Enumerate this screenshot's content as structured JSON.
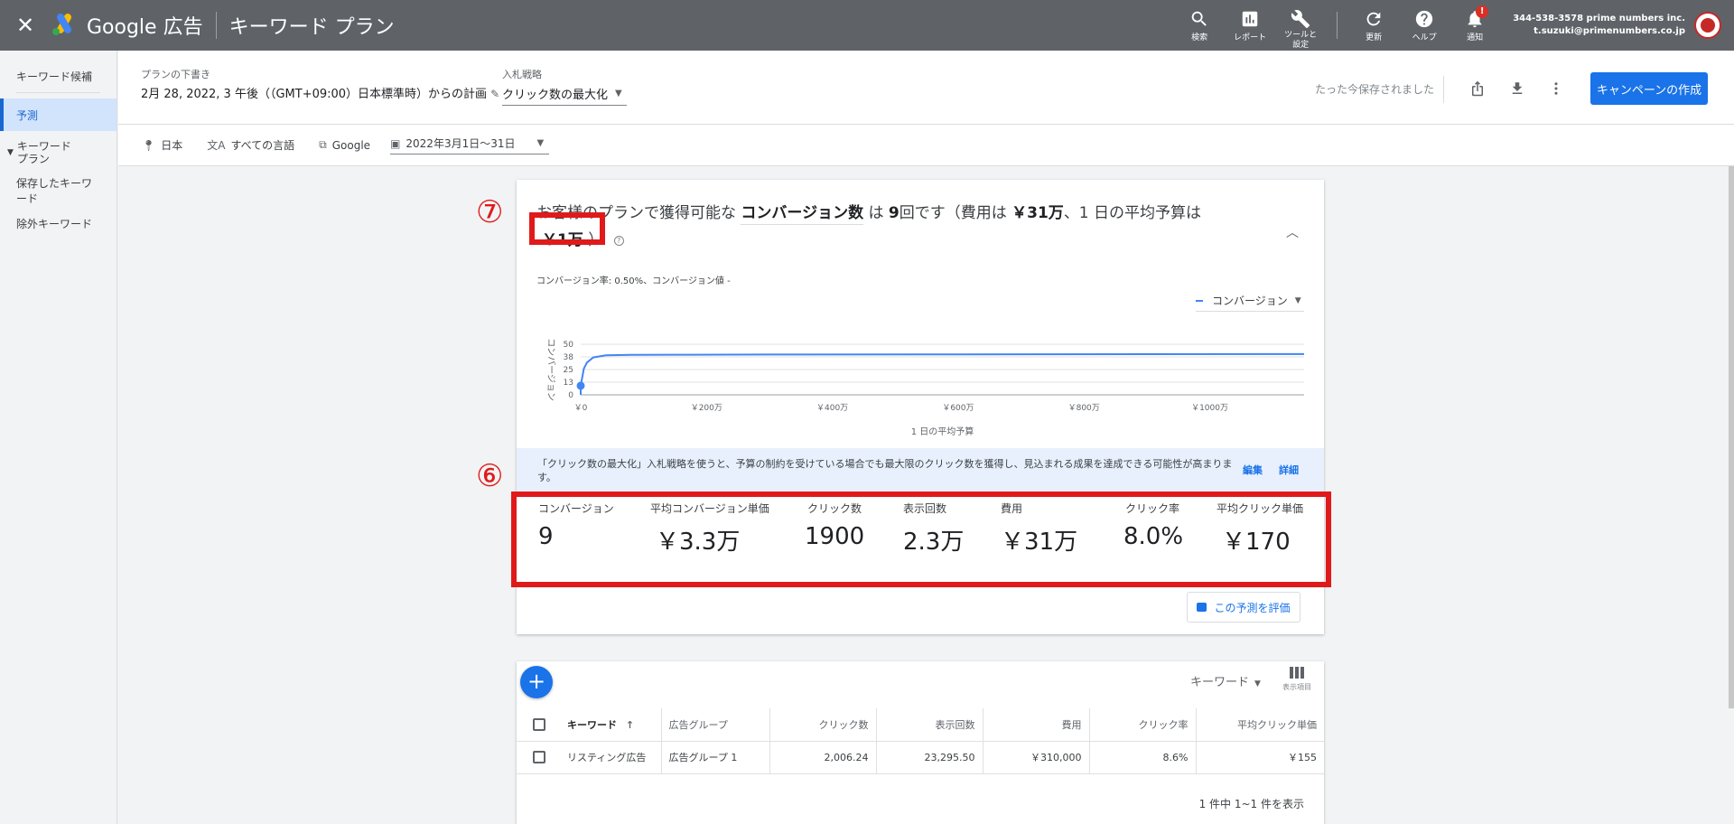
{
  "topbar": {
    "product": "Google 広告",
    "page_title": "キーワード プラン",
    "buttons": [
      {
        "label": "検索",
        "icon": "search-icon"
      },
      {
        "label": "レポート",
        "icon": "report-icon"
      },
      {
        "label": "ツールと設定",
        "icon": "wrench-icon"
      },
      {
        "label": "更新",
        "icon": "refresh-icon"
      },
      {
        "label": "ヘルプ",
        "icon": "help-icon"
      },
      {
        "label": "通知",
        "icon": "bell-icon",
        "badge": "!"
      }
    ],
    "account_id": "344-538-3578 prime numbers inc.",
    "account_email": "t.suzuki@primenumbers.co.jp"
  },
  "sidebar": {
    "items": [
      {
        "label": "キーワード候補"
      },
      {
        "label": "予測",
        "active": true
      },
      {
        "label": "キーワード\nプラン"
      },
      {
        "label": "保存したキーワード"
      },
      {
        "label": "除外キーワード"
      }
    ]
  },
  "header": {
    "plan_label": "プランの下書き",
    "plan_value": "2月 28, 2022, 3 午後（（GMT+09:00）日本標準時）からの計画",
    "bid_label": "入札戦略",
    "bid_value": "クリック数の最大化",
    "saved_text": "たった今保存されました",
    "create_button": "キャンペーンの作成"
  },
  "filters": {
    "location": "日本",
    "language": "すべての言語",
    "network": "Google",
    "date_range": "2022年3月1日～31日"
  },
  "forecast": {
    "headline_pre": "お客様のプランで獲得可能な",
    "headline_metric": "コンバージョン数",
    "headline_mid1": "は",
    "headline_count": "9",
    "headline_mid2": "回です（費用は",
    "headline_cost": "￥31万",
    "headline_mid3": "、1 日の平均予算は",
    "headline_budget": "￥1万",
    "headline_end": "）",
    "subline": "コンバージョン率: 0.50%、コンバージョン値 -",
    "legend_select": "コンバージョン",
    "banner_text": "「クリック数の最大化」入札戦略を使うと、予算の制約を受けている場合でも最大限のクリック数を獲得し、見込まれる成果を達成できる可能性が高まります。",
    "banner_edit": "編集",
    "banner_detail": "詳細",
    "rate_button": "この予測を評価",
    "annotation_7": "⑦",
    "annotation_6": "⑥",
    "metrics": [
      {
        "label": "コンバージョン",
        "value": "9"
      },
      {
        "label": "平均コンバージョン単価",
        "value": "￥3.3万"
      },
      {
        "label": "クリック数",
        "value": "1900"
      },
      {
        "label": "表示回数",
        "value": "2.3万"
      },
      {
        "label": "費用",
        "value": "￥31万"
      },
      {
        "label": "クリック率",
        "value": "8.0%"
      },
      {
        "label": "平均クリック単価",
        "value": "￥170"
      }
    ],
    "colors": {
      "accent": "#1a73e8",
      "line": "#4285f4",
      "annotation": "#e01a1a"
    }
  },
  "chart_data": {
    "type": "line",
    "xlabel": "1 日の平均予算",
    "ylabel": "コンバージョン",
    "x_tick_labels": [
      "￥0",
      "￥200万",
      "￥400万",
      "￥600万",
      "￥800万",
      "￥1000万"
    ],
    "y_tick_labels": [
      "0",
      "13",
      "25",
      "38",
      "50"
    ],
    "xlim": [
      0,
      1150
    ],
    "ylim": [
      0,
      50
    ],
    "x": [
      0,
      5,
      10,
      20,
      40,
      80,
      150,
      300,
      600,
      900,
      1150
    ],
    "values": [
      9,
      26,
      32,
      37,
      39,
      39.5,
      39.6,
      39.8,
      40,
      40.2,
      40.3
    ],
    "marker": {
      "x": 0,
      "y": 9
    }
  },
  "table": {
    "add_button": "+",
    "view_select": "キーワード",
    "columns_label": "表示項目",
    "headers": [
      "キーワード",
      "広告グループ",
      "クリック数",
      "表示回数",
      "費用",
      "クリック率",
      "平均クリック単価"
    ],
    "sort_indicator": "↑",
    "rows": [
      [
        "リスティング広告",
        "広告グループ 1",
        "2,006.24",
        "23,295.50",
        "￥310,000",
        "8.6%",
        "￥155"
      ]
    ],
    "pager": "1 件中 1~1 件を表示"
  }
}
